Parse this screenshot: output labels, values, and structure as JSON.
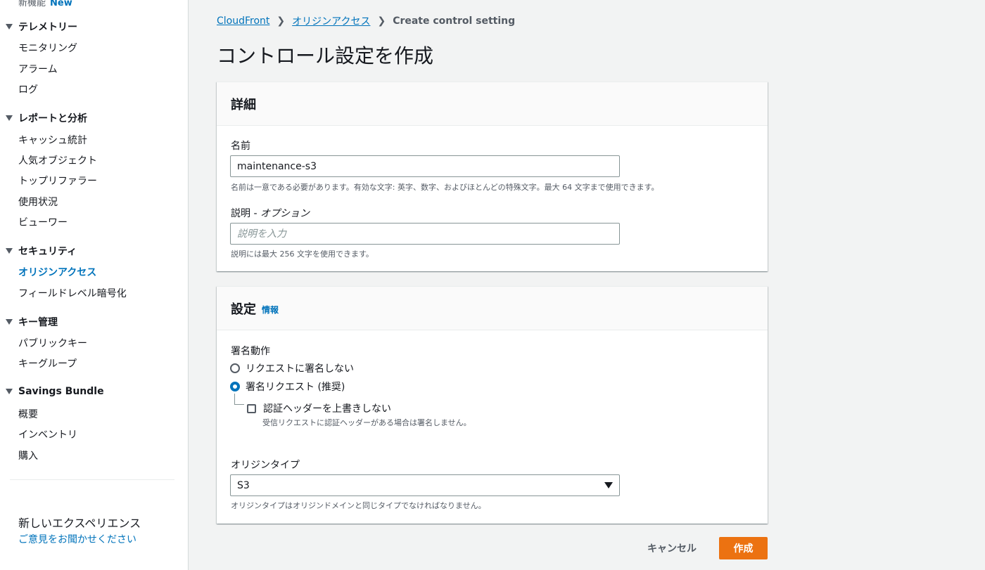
{
  "sidebar": {
    "top_partial": "新機能",
    "top_badge": "New",
    "sections": [
      {
        "title": "テレメトリー",
        "items": [
          "モニタリング",
          "アラーム",
          "ログ"
        ]
      },
      {
        "title": "レポートと分析",
        "items": [
          "キャッシュ統計",
          "人気オブジェクト",
          "トップリファラー",
          "使用状況",
          "ビューワー"
        ]
      },
      {
        "title": "セキュリティ",
        "items": [
          "オリジンアクセス",
          "フィールドレベル暗号化"
        ]
      },
      {
        "title": "キー管理",
        "items": [
          "パブリックキー",
          "キーグループ"
        ]
      },
      {
        "title": "Savings Bundle",
        "items": [
          "概要",
          "インベントリ",
          "購入"
        ]
      }
    ],
    "active_item": "オリジンアクセス",
    "experience_title": "新しいエクスペリエンス",
    "feedback_link": "ご意見をお聞かせください"
  },
  "breadcrumb": {
    "items": [
      "CloudFront",
      "オリジンアクセス"
    ],
    "current": "Create control setting"
  },
  "page_title": "コントロール設定を作成",
  "details_panel": {
    "title": "詳細",
    "name_label": "名前",
    "name_value": "maintenance-s3",
    "name_hint": "名前は一意である必要があります。有効な文字: 英字、数字、およびほとんどの特殊文字。最大 64 文字まで使用できます。",
    "description_label": "説明 - ",
    "description_optional": "オプション",
    "description_placeholder": "説明を入力",
    "description_hint": "説明には最大 256 文字を使用できます。"
  },
  "settings_panel": {
    "title": "設定",
    "info_link": "情報",
    "signing_label": "署名動作",
    "radio_no_sign": "リクエストに署名しない",
    "radio_sign": "署名リクエスト (推奨)",
    "selected_radio": "sign",
    "checkbox_label": "認証ヘッダーを上書きしない",
    "checkbox_hint": "受信リクエストに認証ヘッダーがある場合は署名しません。",
    "checkbox_checked": false,
    "origin_type_label": "オリジンタイプ",
    "origin_type_value": "S3",
    "origin_type_hint": "オリジンタイプはオリジンドメインと同じタイプでなければなりません。"
  },
  "footer": {
    "cancel_label": "キャンセル",
    "create_label": "作成"
  },
  "colors": {
    "link": "#0073bb",
    "primary_button": "#ec7211",
    "background": "#f2f3f3"
  }
}
